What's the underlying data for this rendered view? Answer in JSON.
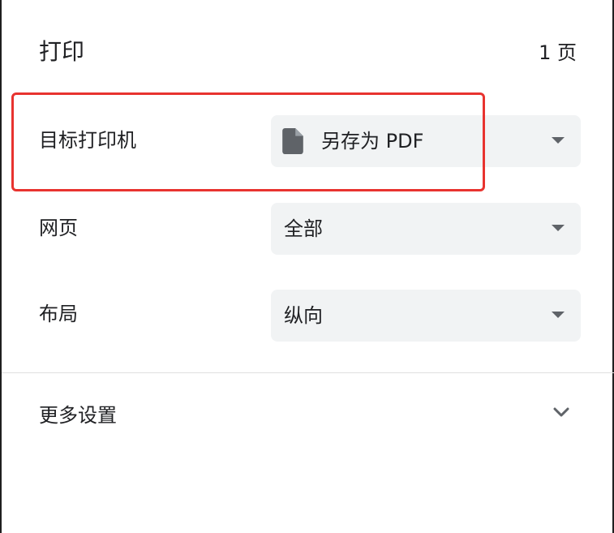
{
  "header": {
    "title": "打印",
    "page_count": "1 页"
  },
  "destination": {
    "label": "目标打印机",
    "value": "另存为 PDF",
    "icon": "file-icon"
  },
  "pages": {
    "label": "网页",
    "value": "全部"
  },
  "layout": {
    "label": "布局",
    "value": "纵向"
  },
  "more_settings": {
    "label": "更多设置",
    "icon": "chevron-down-icon"
  },
  "colors": {
    "select_bg": "#f1f3f4",
    "highlight": "#e8332f",
    "text": "#202124",
    "icon": "#5f6368"
  }
}
